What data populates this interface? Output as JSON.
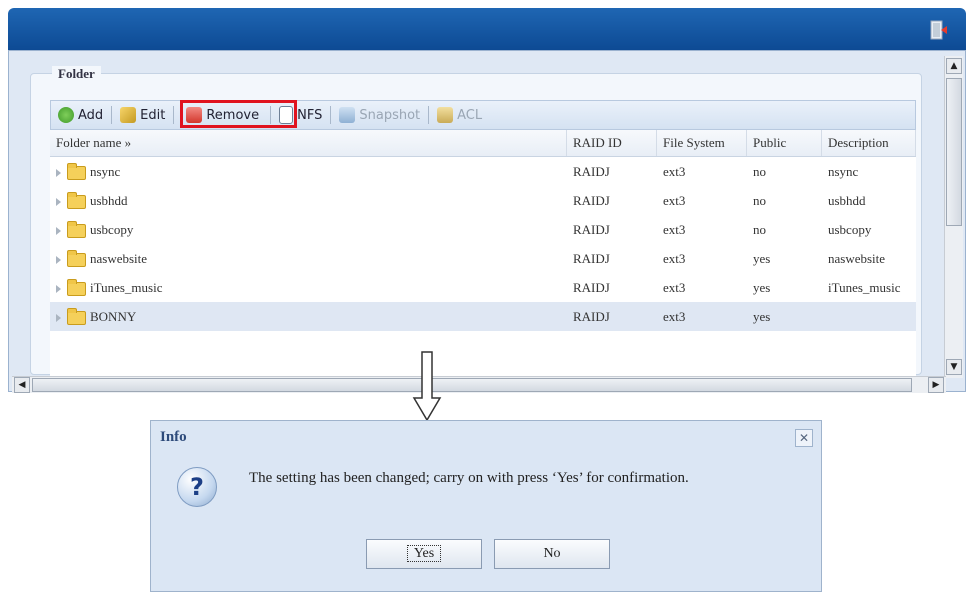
{
  "window": {
    "exit_icon": "exit-door-icon",
    "accent_color": "#0d4a94"
  },
  "folder_panel": {
    "legend": "Folder",
    "toolbar": [
      {
        "label": "Add",
        "icon": "add-icon",
        "enabled": true
      },
      {
        "label": "Edit",
        "icon": "edit-icon",
        "enabled": true
      },
      {
        "label": "Remove",
        "icon": "remove-icon",
        "enabled": true,
        "highlighted": true
      },
      {
        "label": "NFS",
        "icon": "nfs-icon",
        "enabled": true
      },
      {
        "label": "Snapshot",
        "icon": "snapshot-icon",
        "enabled": false
      },
      {
        "label": "ACL",
        "icon": "acl-icon",
        "enabled": false
      }
    ],
    "columns": [
      "Folder name »",
      "RAID ID",
      "File System",
      "Public",
      "Description"
    ],
    "rows": [
      {
        "name": "nsync",
        "raid": "RAIDJ",
        "fs": "ext3",
        "public": "no",
        "desc": "nsync"
      },
      {
        "name": "usbhdd",
        "raid": "RAIDJ",
        "fs": "ext3",
        "public": "no",
        "desc": "usbhdd"
      },
      {
        "name": "usbcopy",
        "raid": "RAIDJ",
        "fs": "ext3",
        "public": "no",
        "desc": "usbcopy"
      },
      {
        "name": "naswebsite",
        "raid": "RAIDJ",
        "fs": "ext3",
        "public": "yes",
        "desc": "naswebsite"
      },
      {
        "name": "iTunes_music",
        "raid": "RAIDJ",
        "fs": "ext3",
        "public": "yes",
        "desc": "iTunes_music"
      },
      {
        "name": "BONNY",
        "raid": "RAIDJ",
        "fs": "ext3",
        "public": "yes",
        "desc": "",
        "selected": true
      }
    ]
  },
  "dialog": {
    "title": "Info",
    "message": "The setting has been changed; carry on with press ‘Yes’ for confirmation.",
    "icon": "question-icon",
    "yes_label": "Yes",
    "no_label": "No"
  }
}
